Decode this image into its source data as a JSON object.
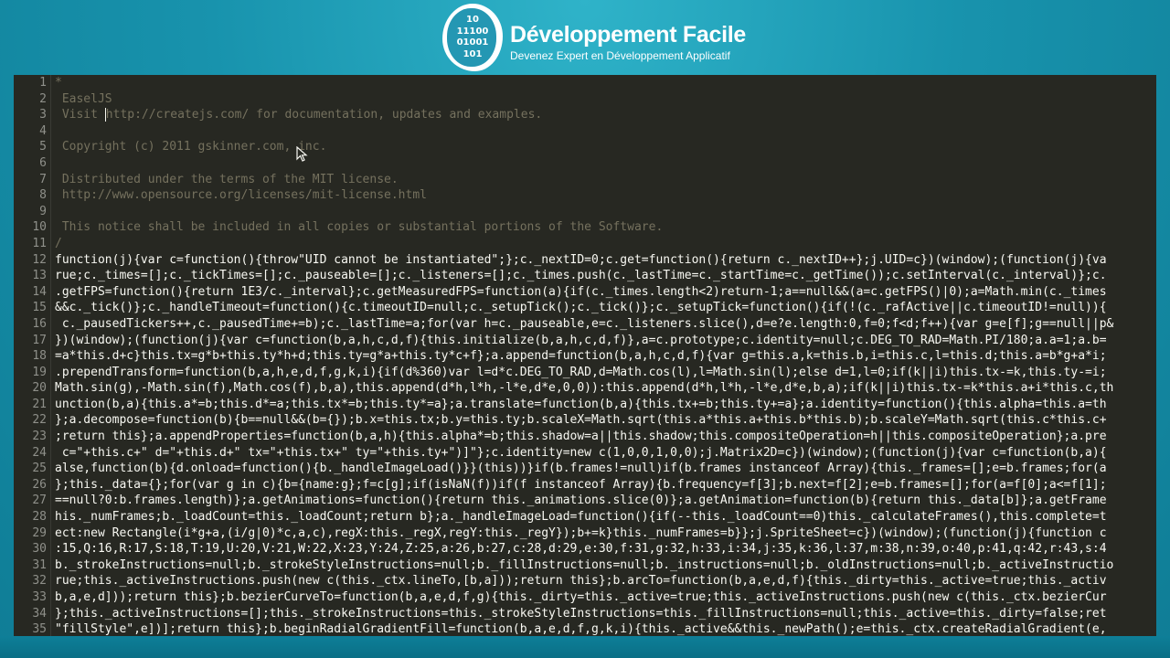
{
  "header": {
    "logo_bits": [
      "10",
      "11100",
      "01001",
      "101"
    ],
    "title": "Développement Facile",
    "subtitle": "Devenez Expert en Développement Applicatif"
  },
  "editor": {
    "theme": {
      "background": "#272822",
      "text": "#f8f8f2",
      "comment": "#75715e",
      "gutter_text": "#8f908a"
    },
    "line_numbers": [
      "1",
      "2",
      "3",
      "4",
      "5",
      "6",
      "7",
      "8",
      "9",
      "10",
      "11",
      "12",
      "13",
      "14",
      "15",
      "16",
      "17",
      "18",
      "19",
      "20",
      "21",
      "22",
      "23",
      "24",
      "25",
      "26",
      "27",
      "28",
      "29",
      "30",
      "31",
      "32",
      "33",
      "34",
      "35"
    ],
    "lines": [
      "*",
      " EaselJS",
      " Visit http://createjs.com/ for documentation, updates and examples.",
      "",
      " Copyright (c) 2011 gskinner.com, inc.",
      "",
      " Distributed under the terms of the MIT license.",
      " http://www.opensource.org/licenses/mit-license.html",
      "",
      " This notice shall be included in all copies or substantial portions of the Software.",
      "/",
      "function(j){var c=function(){throw\"UID cannot be instantiated\";};c._nextID=0;c.get=function(){return c._nextID++};j.UID=c})(window);(function(j){va",
      "rue;c._times=[];c._tickTimes=[];c._pauseable=[];c._listeners=[];c._times.push(c._lastTime=c._startTime=c._getTime());c.setInterval(c._interval)};c.",
      ".getFPS=function(){return 1E3/c._interval};c.getMeasuredFPS=function(a){if(c._times.length<2)return-1;a==null&&(a=c.getFPS()|0);a=Math.min(c._times",
      "&&c._tick()};c._handleTimeout=function(){c.timeoutID=null;c._setupTick();c._tick()};c._setupTick=function(){if(!(c._rafActive||c.timeoutID!=null)){",
      " c._pausedTickers++,c._pausedTime+=b);c._lastTime=a;for(var h=c._pauseable,e=c._listeners.slice(),d=e?e.length:0,f=0;f<d;f++){var g=e[f];g==null||p&",
      "})(window);(function(j){var c=function(b,a,h,c,d,f){this.initialize(b,a,h,c,d,f)},a=c.prototype;c.identity=null;c.DEG_TO_RAD=Math.PI/180;a.a=1;a.b=",
      "=a*this.d+c}this.tx=g*b+this.ty*h+d;this.ty=g*a+this.ty*c+f};a.append=function(b,a,h,c,d,f){var g=this.a,k=this.b,i=this.c,l=this.d;this.a=b*g+a*i;",
      ".prependTransform=function(b,a,h,e,d,f,g,k,i){if(d%360)var l=d*c.DEG_TO_RAD,d=Math.cos(l),l=Math.sin(l);else d=1,l=0;if(k||i)this.tx-=k,this.ty-=i;",
      "Math.sin(g),-Math.sin(f),Math.cos(f),b,a),this.append(d*h,l*h,-l*e,d*e,0,0)):this.append(d*h,l*h,-l*e,d*e,b,a);if(k||i)this.tx-=k*this.a+i*this.c,th",
      "unction(b,a){this.a*=b;this.d*=a;this.tx*=b;this.ty*=a};a.translate=function(b,a){this.tx+=b;this.ty+=a};a.identity=function(){this.alpha=this.a=th",
      "};a.decompose=function(b){b==null&&(b={});b.x=this.tx;b.y=this.ty;b.scaleX=Math.sqrt(this.a*this.a+this.b*this.b);b.scaleY=Math.sqrt(this.c*this.c+",
      ";return this};a.appendProperties=function(b,a,h){this.alpha*=b;this.shadow=a||this.shadow;this.compositeOperation=h||this.compositeOperation};a.pre",
      " c=\"+this.c+\" d=\"+this.d+\" tx=\"+this.tx+\" ty=\"+this.ty+\")]\"};c.identity=new c(1,0,0,1,0,0);j.Matrix2D=c})(window);(function(j){var c=function(b,a){",
      "alse,function(b){d.onload=function(){b._handleImageLoad()}}(this))}if(b.frames!=null)if(b.frames instanceof Array){this._frames=[];e=b.frames;for(a",
      "};this._data={};for(var g in c){b={name:g};f=c[g];if(isNaN(f))if(f instanceof Array){b.frequency=f[3];b.next=f[2];e=b.frames=[];for(a=f[0];a<=f[1];",
      "==null?0:b.frames.length)};a.getAnimations=function(){return this._animations.slice(0)};a.getAnimation=function(b){return this._data[b]};a.getFrame",
      "his._numFrames;b._loadCount=this._loadCount;return b};a._handleImageLoad=function(){if(--this._loadCount==0)this._calculateFrames(),this.complete=t",
      "ect:new Rectangle(i*g+a,(i/g|0)*c,a,c),regX:this._regX,regY:this._regY});b+=k}this._numFrames=b}};j.SpriteSheet=c})(window);(function(j){function c",
      ":15,Q:16,R:17,S:18,T:19,U:20,V:21,W:22,X:23,Y:24,Z:25,a:26,b:27,c:28,d:29,e:30,f:31,g:32,h:33,i:34,j:35,k:36,l:37,m:38,n:39,o:40,p:41,q:42,r:43,s:4",
      "b._strokeInstructions=null;b._strokeStyleInstructions=null;b._fillInstructions=null;b._instructions=null;b._oldInstructions=null;b._activeInstructio",
      "rue;this._activeInstructions.push(new c(this._ctx.lineTo,[b,a]));return this};b.arcTo=function(b,a,e,d,f){this._dirty=this._active=true;this._activ",
      "b,a,e,d]));return this};b.bezierCurveTo=function(b,a,e,d,f,g){this._dirty=this._active=true;this._activeInstructions.push(new c(this._ctx.bezierCur",
      "};this._activeInstructions=[];this._strokeInstructions=this._strokeStyleInstructions=this._fillInstructions=null;this._active=this._dirty=false;ret",
      "\"fillStyle\",e])];return this};b.beginRadialGradientFill=function(b,a,e,d,f,g,k,i){this._active&&this._newPath();e=this._ctx.createRadialGradient(e,"
    ]
  }
}
